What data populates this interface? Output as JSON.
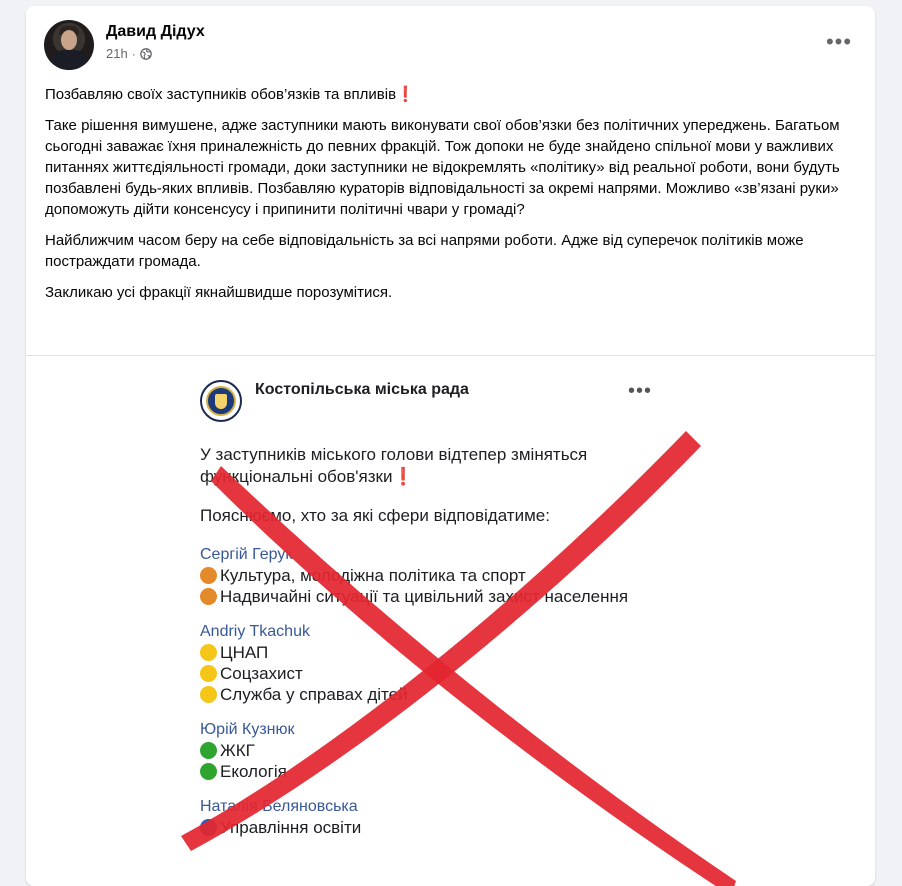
{
  "post": {
    "author": "Давид Дідух",
    "time": "21h",
    "separator": "·",
    "more": "•••",
    "paragraphs": [
      "Позбавляю своїх заступників обов’язків та впливів❗",
      "Таке рішення вимушене, адже заступники мають виконувати свої обов’язки без політичних упереджень. Багатьом сьогодні заважає їхня приналежність до певних фракцій. Тож допоки не буде знайдено спільної мови у важливих питаннях життєдіяльності громади, доки заступники не відокремлять «політику» від реальної роботи, вони будуть позбавлені будь-яких впливів. Позбавляю кураторів відповідальності за окремі напрями. Можливо «зв’язані руки» допоможуть дійти консенсусу і припинити політичні чвари у громаді?",
      "Найближчим часом беру на себе відповідальність за всі напрями роботи. Адже від суперечок політиків може постраждати громада.",
      "Закликаю усі фракції якнайшвидше порозумітися."
    ]
  },
  "embedded": {
    "page_name": "Костопільська міська рада",
    "more": "•••",
    "intro_line1": "У заступників міського голови відтепер зміняться",
    "intro_line2": "функціональні обов'язки❗",
    "intro2": "Пояснюємо, хто за які сфери відповідатиме:",
    "groups": [
      {
        "name": "Сергій Герук",
        "dot_color": "#e58a2b",
        "items": [
          "Культура, молодіжна політика та спорт",
          "Надвичайні ситуації та цивільний захист населення"
        ]
      },
      {
        "name": "Andriy Tkachuk",
        "dot_color": "#f5c518",
        "items": [
          "ЦНАП",
          "Соцзахист",
          "Служба у справах дітей"
        ]
      },
      {
        "name": "Юрій Кузнюк",
        "dot_color": "#2fa52f",
        "items": [
          " ЖКГ",
          " Екологія"
        ]
      },
      {
        "name": "Наталія Беляновська",
        "dot_color": "#2d5fb8",
        "items": [
          "Управління освіти"
        ]
      }
    ]
  },
  "overlay": {
    "cross_color": "#e3262f"
  }
}
